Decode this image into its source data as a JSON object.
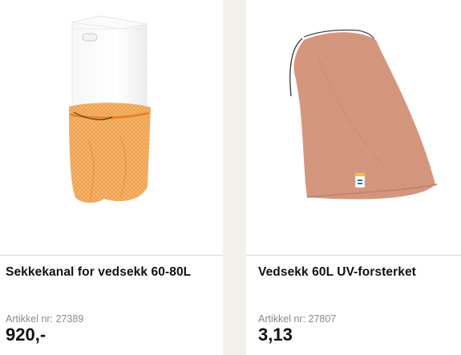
{
  "products": [
    {
      "title": "Sekkekanal for vedsekk 60-80L",
      "article_label": "Artikkel nr: 27389",
      "price": "920,-",
      "image": "sack-chute-with-orange-mesh-bag"
    },
    {
      "title": "Vedsekk 60L UV-forsterket",
      "article_label": "Artikkel nr: 27807",
      "price": "3,13",
      "image": "orange-mesh-firewood-sack"
    }
  ],
  "colors": {
    "page_background": "#f4f1ed",
    "card_background": "#ffffff",
    "article_text": "#8a8a8a",
    "mesh_orange": "#f0a24a",
    "mesh_salmon": "#d99a82"
  }
}
